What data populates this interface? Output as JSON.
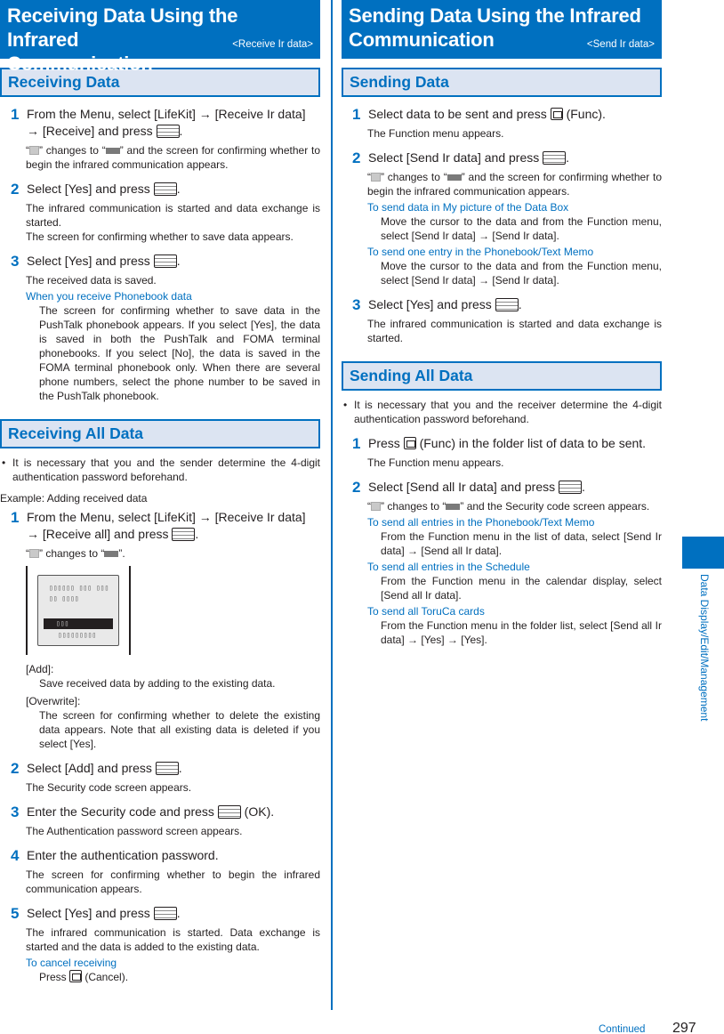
{
  "left": {
    "title_line1": "Receiving Data Using the Infrared",
    "title_line2": "Communication",
    "title_tag": "<Receive Ir data>",
    "sec1": {
      "heading": "Receiving Data",
      "steps": [
        {
          "num": "1",
          "text_a": "From the Menu, select [LifeKit] → [Receive Ir data] → [Receive] and press ",
          "text_b": ".",
          "desc_a": "“",
          "desc_b": "” changes to “",
          "desc_c": "” and the screen for confirming whether to begin the infrared communication appears."
        },
        {
          "num": "2",
          "text_a": "Select [Yes] and press ",
          "text_b": ".",
          "desc1": "The infrared communication is started and data exchange is started.",
          "desc2": "The screen for confirming whether to save data appears."
        },
        {
          "num": "3",
          "text_a": "Select [Yes] and press ",
          "text_b": ".",
          "desc1": "The received data is saved.",
          "note_title": "When you receive Phonebook data",
          "note_body": "The screen for confirming whether to save data in the PushTalk phonebook appears. If you select [Yes], the data is saved in both the PushTalk and FOMA terminal phonebooks. If you select [No], the data is saved in the FOMA terminal phonebook only. When there are several phone numbers, select the phone number to be saved in the PushTalk phonebook."
        }
      ]
    },
    "sec2": {
      "heading": "Receiving All Data",
      "bullet": "It is necessary that you and the sender determine the 4-digit authentication password beforehand.",
      "example": "Example: Adding received data",
      "step1": {
        "num": "1",
        "text_a": "From the Menu, select [LifeKit] → [Receive Ir data] → [Receive all] and press ",
        "text_b": ".",
        "desc_a": "“",
        "desc_b": "” changes to “",
        "desc_c": "”."
      },
      "screen": {
        "line1": "▯▯▯▯▯▯ ▯▯▯ ▯▯▯",
        "line2": "▯▯ ▯▯▯▯",
        "line3": "▯▯▯",
        "line4": "▯▯▯▯▯▯▯▯▯"
      },
      "defs": [
        {
          "term": "[Add]:",
          "def": "Save received data by adding to the existing data."
        },
        {
          "term": "[Overwrite]:",
          "def": "The screen for confirming whether to delete the existing data appears. Note that all existing data is deleted if you select [Yes]."
        }
      ],
      "step2": {
        "num": "2",
        "text_a": "Select [Add] and press ",
        "text_b": ".",
        "desc": "The Security code screen appears."
      },
      "step3": {
        "num": "3",
        "text_a": "Enter the Security code and press ",
        "text_b": " (OK).",
        "desc": "The Authentication password screen appears."
      },
      "step4": {
        "num": "4",
        "text": "Enter the authentication password.",
        "desc": "The screen for confirming whether to begin the infrared communication appears."
      },
      "step5": {
        "num": "5",
        "text_a": "Select [Yes] and press ",
        "text_b": ".",
        "desc": "The infrared communication is started. Data exchange is started and the data is added to the existing data.",
        "note_title": "To cancel receiving",
        "note_a": "Press ",
        "note_b": " (Cancel)."
      }
    }
  },
  "right": {
    "title_line1": "Sending Data Using the Infrared",
    "title_line2": "Communication",
    "title_tag": "<Send Ir data>",
    "sec1": {
      "heading": "Sending Data",
      "step1": {
        "num": "1",
        "text_a": "Select data to be sent and press ",
        "text_b": " (Func).",
        "desc": "The Function menu appears."
      },
      "step2": {
        "num": "2",
        "text_a": "Select [Send Ir data] and press ",
        "text_b": ".",
        "desc_a": "“",
        "desc_b": "” changes to “",
        "desc_c": "” and the screen for confirming whether to begin the infrared communication appears.",
        "notes": [
          {
            "title": "To send data in My picture of the Data Box",
            "body": "Move the cursor to the data and from the Function menu, select [Send Ir data] → [Send Ir data]."
          },
          {
            "title": "To send one entry in the Phonebook/Text Memo",
            "body": "Move the cursor to the data and from the Function menu, select [Send Ir data] → [Send Ir data]."
          }
        ]
      },
      "step3": {
        "num": "3",
        "text_a": "Select [Yes] and press ",
        "text_b": ".",
        "desc": "The infrared communication is started and data exchange is started."
      }
    },
    "sec2": {
      "heading": "Sending All Data",
      "bullet": "It is necessary that you and the receiver determine the 4-digit authentication password beforehand.",
      "step1": {
        "num": "1",
        "text_a": "Press ",
        "text_b": " (Func) in the folder list of data to be sent.",
        "desc": "The Function menu appears."
      },
      "step2": {
        "num": "2",
        "text_a": "Select [Send all Ir data] and press ",
        "text_b": ".",
        "desc_a": "“",
        "desc_b": "” changes to “",
        "desc_c": "” and the Security code screen appears.",
        "notes": [
          {
            "title": "To send all entries in the Phonebook/Text Memo",
            "body": "From the Function menu in the list of data, select [Send Ir data] → [Send all Ir data]."
          },
          {
            "title": "To send all entries in the Schedule",
            "body": "From the Function menu in the calendar display, select [Send all Ir data]."
          },
          {
            "title": "To send all ToruCa cards",
            "body": "From the Function menu in the folder list, select [Send all Ir data] → [Yes] → [Yes]."
          }
        ]
      }
    }
  },
  "side_tab": {
    "label": "Data Display/Edit/Management",
    "color": "#0070c0"
  },
  "footer": {
    "continued": "Continued",
    "page_number": "297"
  },
  "colors": {
    "accent": "#0070c0",
    "heading_bg": "#dce4f2",
    "text": "#231f20"
  }
}
